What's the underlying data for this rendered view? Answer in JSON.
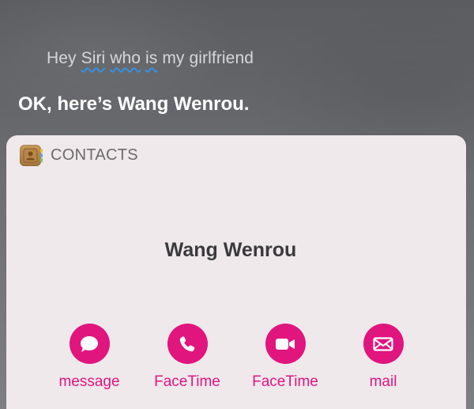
{
  "siri": {
    "query_words": [
      "Hey",
      "Siri",
      "who",
      "is",
      "my",
      "girlfriend"
    ],
    "response": "OK, here’s Wang Wenrou."
  },
  "card": {
    "title": "CONTACTS",
    "app_icon": "contacts-book-icon",
    "contact_name": "Wang Wenrou"
  },
  "actions": [
    {
      "label": "message",
      "icon": "message-bubble-icon"
    },
    {
      "label": "FaceTime",
      "icon": "phone-icon"
    },
    {
      "label": "FaceTime",
      "icon": "video-camera-icon"
    },
    {
      "label": "mail",
      "icon": "envelope-icon"
    }
  ],
  "colors": {
    "accent": "#e0157e",
    "card_background": "#efe9ec",
    "spell_underline": "#3a8fe0"
  }
}
